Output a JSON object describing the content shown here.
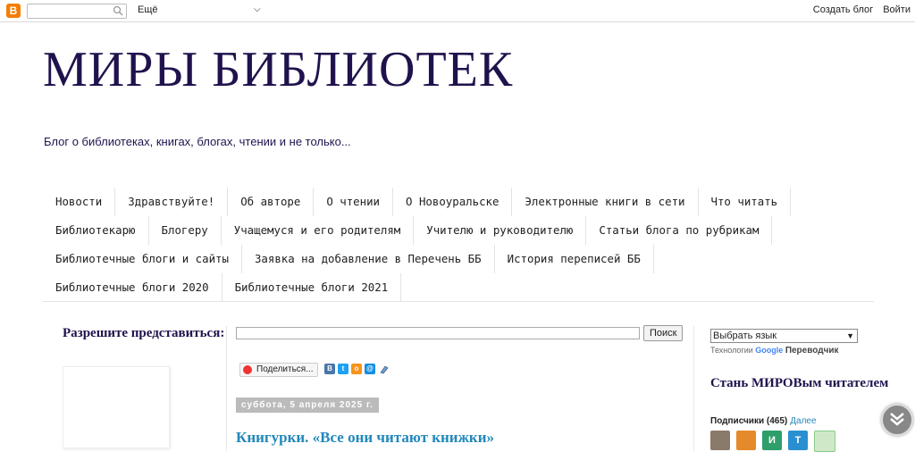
{
  "navbar": {
    "logo": "B",
    "more_label": "Ещё",
    "create_blog": "Создать блог",
    "login": "Войти"
  },
  "header": {
    "title": "МИРЫ БИБЛИОТЕК",
    "description": "Блог о библиотеках, книгах, блогах, чтении и не только..."
  },
  "tabs": [
    [
      "Новости",
      "Здравствуйте!",
      "Об авторе",
      "О чтении",
      "О Новоуральске",
      "Электронные книги в сети",
      "Что читать"
    ],
    [
      "Библиотекарю",
      "Блогеру",
      "Учащемуся и его родителям",
      "Учителю и руководителю",
      "Статьи блога по рубрикам"
    ],
    [
      "Библиотечные блоги и сайты",
      "Заявка на добавление в Перечень ББ",
      "История переписей ББ"
    ],
    [
      "Библиотечные блоги 2020",
      "Библиотечные блоги 2021"
    ]
  ],
  "left_sidebar": {
    "title": "Разрешите представиться:"
  },
  "main": {
    "search_button": "Поиск",
    "share_label": "Поделиться...",
    "date": "суббота, 5 апреля 2025 г.",
    "post_title": "Книгурки. «Все они читают книжки»"
  },
  "right_sidebar": {
    "language_select": "Выбрать язык",
    "powered_prefix": "Технологии",
    "powered_google": "Google",
    "powered_translate": "Переводчик",
    "followers_title": "Стань МИРОВым читателем",
    "followers_label": "Подписчики (465)",
    "followers_more": "Далее"
  },
  "colors": {
    "title": "#20124d",
    "link": "#2288bb",
    "blogger_orange": "#f57d00"
  }
}
